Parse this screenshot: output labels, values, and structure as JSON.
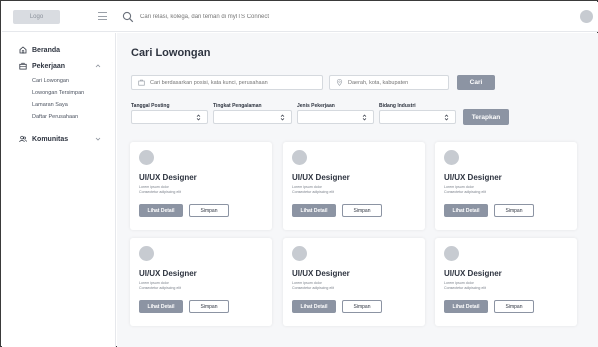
{
  "topbar": {
    "logo": "Logo",
    "search_placeholder": "Cari relasi, kolega, dan teman di myITS Connect"
  },
  "sidebar": {
    "items": [
      {
        "label": "Beranda",
        "icon": "home-icon"
      },
      {
        "label": "Pekerjaan",
        "icon": "briefcase-icon",
        "expanded": true,
        "children": [
          "Cari Lowongan",
          "Lowongan Tersimpan",
          "Lamaran Saya",
          "Daftar Perusahaan"
        ]
      },
      {
        "label": "Komunitas",
        "icon": "users-icon",
        "expanded": false
      }
    ]
  },
  "main": {
    "title": "Cari Lowongan",
    "search": {
      "keyword_placeholder": "Cari berdasarkan posisi, kata kunci, perusahaan",
      "location_placeholder": "Daerah, kota, kabupaten",
      "button": "Cari"
    },
    "filters": [
      {
        "label": "Tanggal Posting"
      },
      {
        "label": "Tingkat Pengalaman"
      },
      {
        "label": "Jenis Pekerjaan"
      },
      {
        "label": "Bidang Industri"
      }
    ],
    "apply_button": "Terapkan",
    "cards": [
      {
        "title": "UI/UX Designer",
        "line1": "Lorem ipsum dolor",
        "line2": "Consectetur adipiscing elit",
        "detail": "Lihat Detail",
        "save": "Simpan"
      },
      {
        "title": "UI/UX Designer",
        "line1": "Lorem ipsum dolor",
        "line2": "Consectetur adipiscing elit",
        "detail": "Lihat Detail",
        "save": "Simpan"
      },
      {
        "title": "UI/UX Designer",
        "line1": "Lorem ipsum dolor",
        "line2": "Consectetur adipiscing elit",
        "detail": "Lihat Detail",
        "save": "Simpan"
      },
      {
        "title": "UI/UX Designer",
        "line1": "Lorem ipsum dolor",
        "line2": "Consectetur adipiscing elit",
        "detail": "Lihat Detail",
        "save": "Simpan"
      },
      {
        "title": "UI/UX Designer",
        "line1": "Lorem ipsum dolor",
        "line2": "Consectetur adipiscing elit",
        "detail": "Lihat Detail",
        "save": "Simpan"
      },
      {
        "title": "UI/UX Designer",
        "line1": "Lorem ipsum dolor",
        "line2": "Consectetur adipiscing elit",
        "detail": "Lihat Detail",
        "save": "Simpan"
      }
    ]
  },
  "colors": {
    "button_fill": "#8c94a3",
    "main_background": "#f6f7f9",
    "card_background": "#ffffff"
  }
}
